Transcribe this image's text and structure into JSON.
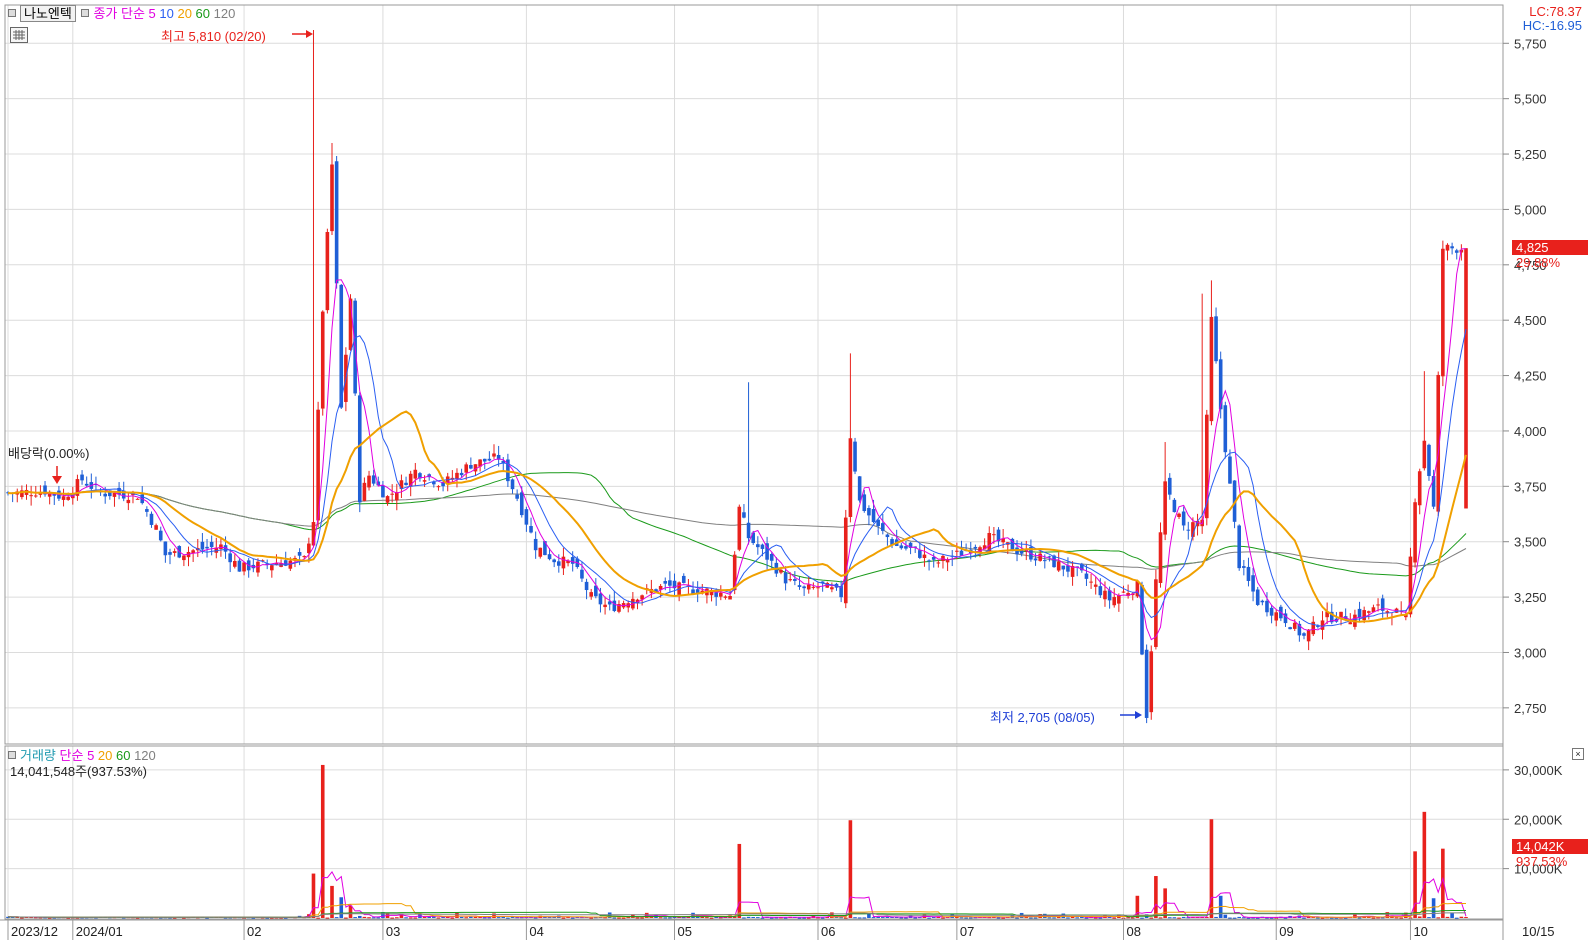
{
  "header": {
    "stock_name": "나노엔텍",
    "ma_label": "종가 단순",
    "ma_periods": [
      {
        "label": "5",
        "color": "#e100e1"
      },
      {
        "label": "10",
        "color": "#2b5ff2"
      },
      {
        "label": "20",
        "color": "#f0a000"
      },
      {
        "label": "60",
        "color": "#1a9a1a"
      },
      {
        "label": "120",
        "color": "#808080"
      }
    ],
    "lc": "LC:78.37",
    "hc": "HC:-16.95"
  },
  "annotations": {
    "high": "최고 5,810 (02/20)",
    "low": "최저 2,705 (08/05)",
    "dividend": "배당락(0.00%)"
  },
  "price_panel": {
    "current_price": "4,825",
    "current_change": "29.88%",
    "y_ticks": [
      "5,750",
      "5,500",
      "5,250",
      "5,000",
      "4,750",
      "4,500",
      "4,250",
      "4,000",
      "3,750",
      "3,500",
      "3,250",
      "3,000",
      "2,750"
    ]
  },
  "volume_panel": {
    "title": "거래량",
    "ma_label": "단순",
    "ma_periods": [
      {
        "label": "5",
        "color": "#e100e1"
      },
      {
        "label": "20",
        "color": "#f0a000"
      },
      {
        "label": "60",
        "color": "#1a9a1a"
      },
      {
        "label": "120",
        "color": "#808080"
      }
    ],
    "current_volume": "14,041,548주(937.53%)",
    "current_volume_tag": "14,042K",
    "current_volume_pct": "937.53%",
    "y_ticks": [
      "30,000K",
      "20,000K",
      "10,000K"
    ]
  },
  "x_axis": {
    "labels": [
      "2023/12",
      "2024/01",
      "02",
      "03",
      "04",
      "05",
      "06",
      "07",
      "08",
      "09",
      "10"
    ],
    "right_label": "10/15"
  },
  "colors": {
    "up": "#e8211c",
    "down": "#1f5fd6",
    "grid": "#dcdcdc"
  },
  "chart_data": {
    "type": "candlestick",
    "y_range": [
      2650,
      5810
    ],
    "volume_range": [
      0,
      32000
    ],
    "months": [
      {
        "label": "2023/12",
        "start": 0
      },
      {
        "label": "2024/01",
        "start": 14
      },
      {
        "label": "02",
        "start": 51
      },
      {
        "label": "03",
        "start": 81
      },
      {
        "label": "04",
        "start": 112
      },
      {
        "label": "05",
        "start": 144
      },
      {
        "label": "06",
        "start": 175
      },
      {
        "label": "07",
        "start": 205
      },
      {
        "label": "08",
        "start": 241
      },
      {
        "label": "09",
        "start": 274
      },
      {
        "label": "10",
        "start": 303
      }
    ],
    "total_bars": 316,
    "close_path": [
      [
        0,
        3720
      ],
      [
        8,
        3730
      ],
      [
        12,
        3700
      ],
      [
        16,
        3780
      ],
      [
        20,
        3720
      ],
      [
        28,
        3710
      ],
      [
        32,
        3560
      ],
      [
        34,
        3440
      ],
      [
        40,
        3460
      ],
      [
        46,
        3480
      ],
      [
        50,
        3380
      ],
      [
        56,
        3400
      ],
      [
        64,
        3420
      ],
      [
        66,
        3600
      ],
      [
        68,
        4550
      ],
      [
        70,
        5200
      ],
      [
        72,
        4100
      ],
      [
        74,
        4600
      ],
      [
        76,
        3700
      ],
      [
        78,
        3800
      ],
      [
        82,
        3700
      ],
      [
        88,
        3820
      ],
      [
        94,
        3760
      ],
      [
        100,
        3850
      ],
      [
        106,
        3880
      ],
      [
        110,
        3700
      ],
      [
        114,
        3480
      ],
      [
        118,
        3420
      ],
      [
        122,
        3400
      ],
      [
        126,
        3250
      ],
      [
        130,
        3200
      ],
      [
        136,
        3260
      ],
      [
        142,
        3300
      ],
      [
        150,
        3280
      ],
      [
        156,
        3260
      ],
      [
        158,
        3650
      ],
      [
        160,
        3520
      ],
      [
        164,
        3430
      ],
      [
        168,
        3330
      ],
      [
        172,
        3280
      ],
      [
        176,
        3300
      ],
      [
        180,
        3260
      ],
      [
        182,
        3980
      ],
      [
        184,
        3680
      ],
      [
        188,
        3560
      ],
      [
        192,
        3480
      ],
      [
        196,
        3460
      ],
      [
        200,
        3400
      ],
      [
        206,
        3450
      ],
      [
        212,
        3520
      ],
      [
        218,
        3460
      ],
      [
        224,
        3420
      ],
      [
        232,
        3350
      ],
      [
        238,
        3240
      ],
      [
        244,
        3300
      ],
      [
        246,
        2720
      ],
      [
        248,
        3320
      ],
      [
        250,
        3750
      ],
      [
        254,
        3560
      ],
      [
        258,
        3600
      ],
      [
        260,
        4500
      ],
      [
        262,
        4100
      ],
      [
        264,
        3750
      ],
      [
        266,
        3400
      ],
      [
        270,
        3230
      ],
      [
        276,
        3150
      ],
      [
        280,
        3070
      ],
      [
        284,
        3160
      ],
      [
        290,
        3160
      ],
      [
        296,
        3200
      ],
      [
        300,
        3180
      ],
      [
        302,
        3150
      ],
      [
        304,
        3700
      ],
      [
        306,
        3960
      ],
      [
        308,
        3650
      ],
      [
        310,
        4825
      ]
    ],
    "spikes": [
      [
        66,
        5810
      ],
      [
        70,
        5300
      ],
      [
        160,
        4220
      ],
      [
        182,
        4350
      ],
      [
        250,
        3950
      ],
      [
        258,
        4620
      ],
      [
        260,
        4680
      ],
      [
        306,
        4270
      ],
      [
        310,
        4825
      ]
    ],
    "volume_bars": [
      [
        66,
        9000
      ],
      [
        68,
        31000
      ],
      [
        70,
        6500
      ],
      [
        72,
        4200
      ],
      [
        74,
        2500
      ],
      [
        158,
        15000
      ],
      [
        182,
        19800
      ],
      [
        244,
        4500
      ],
      [
        248,
        8500
      ],
      [
        250,
        6000
      ],
      [
        260,
        20000
      ],
      [
        262,
        4500
      ],
      [
        304,
        13500
      ],
      [
        306,
        21500
      ],
      [
        308,
        4000
      ],
      [
        310,
        14042
      ]
    ],
    "ma_lines": [
      {
        "period": 5,
        "color": "#e100e1"
      },
      {
        "period": 10,
        "color": "#2b5ff2"
      },
      {
        "period": 20,
        "color": "#f0a000"
      },
      {
        "period": 60,
        "color": "#1a9a1a"
      },
      {
        "period": 120,
        "color": "#808080"
      }
    ]
  }
}
